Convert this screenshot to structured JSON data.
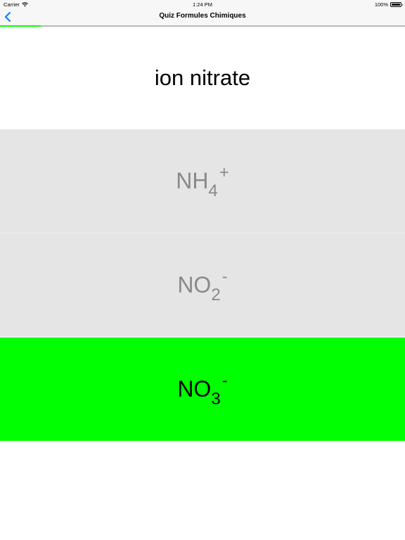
{
  "status_bar": {
    "carrier": "Carrier",
    "time": "1:24 PM",
    "battery": "100%"
  },
  "nav": {
    "title": "Quiz Formules Chimiques",
    "back_icon": "chevron-left-icon",
    "progress_fraction": 0.1
  },
  "question": {
    "text": "ion nitrate"
  },
  "answers": [
    {
      "base": "NH",
      "subscript": "4",
      "superscript": "+",
      "state": "unselected"
    },
    {
      "base": "NO",
      "subscript": "2",
      "superscript": "-",
      "state": "unselected"
    },
    {
      "base": "NO",
      "subscript": "3",
      "superscript": "-",
      "state": "correct"
    }
  ],
  "colors": {
    "accent": "#007aff",
    "correct": "#00ff00",
    "unselected": "#e5e5e5",
    "unselected_text": "#8a8a8a"
  }
}
